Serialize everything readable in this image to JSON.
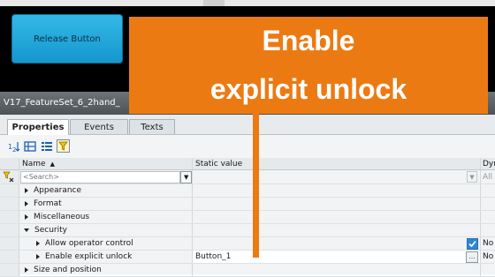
{
  "preview": {
    "button_label": "Release Button"
  },
  "panel": {
    "title": "V17_FeatureSet_6_2hand_",
    "tabs": [
      "Properties",
      "Events",
      "Texts"
    ],
    "active_tab": "Properties",
    "toolbar_icons": [
      "sort-icon",
      "categorize-icon",
      "list-view-icon",
      "filter-icon"
    ]
  },
  "grid": {
    "headers": {
      "name": "Name",
      "value": "Static value",
      "dynamic": "Dyn"
    },
    "search": {
      "placeholder": "<Search>",
      "dynamic_value": "All"
    },
    "rows": [
      {
        "label": "Appearance",
        "state": "collapsed",
        "level": 0
      },
      {
        "label": "Format",
        "state": "collapsed",
        "level": 0
      },
      {
        "label": "Miscellaneous",
        "state": "collapsed",
        "level": 0
      },
      {
        "label": "Security",
        "state": "expanded",
        "level": 0
      },
      {
        "label": "Allow operator control",
        "state": "collapsed",
        "level": 1,
        "checked": true,
        "dynamic": "No"
      },
      {
        "label": "Enable explicit unlock",
        "state": "collapsed",
        "level": 1,
        "value": "Button_1",
        "dynamic": "No"
      },
      {
        "label": "Size and position",
        "state": "collapsed",
        "level": 0
      }
    ]
  },
  "callout": {
    "line1": "Enable",
    "line2": "explicit unlock"
  },
  "colors": {
    "accent": "#ec7a13",
    "button": "#1e9fd4"
  }
}
